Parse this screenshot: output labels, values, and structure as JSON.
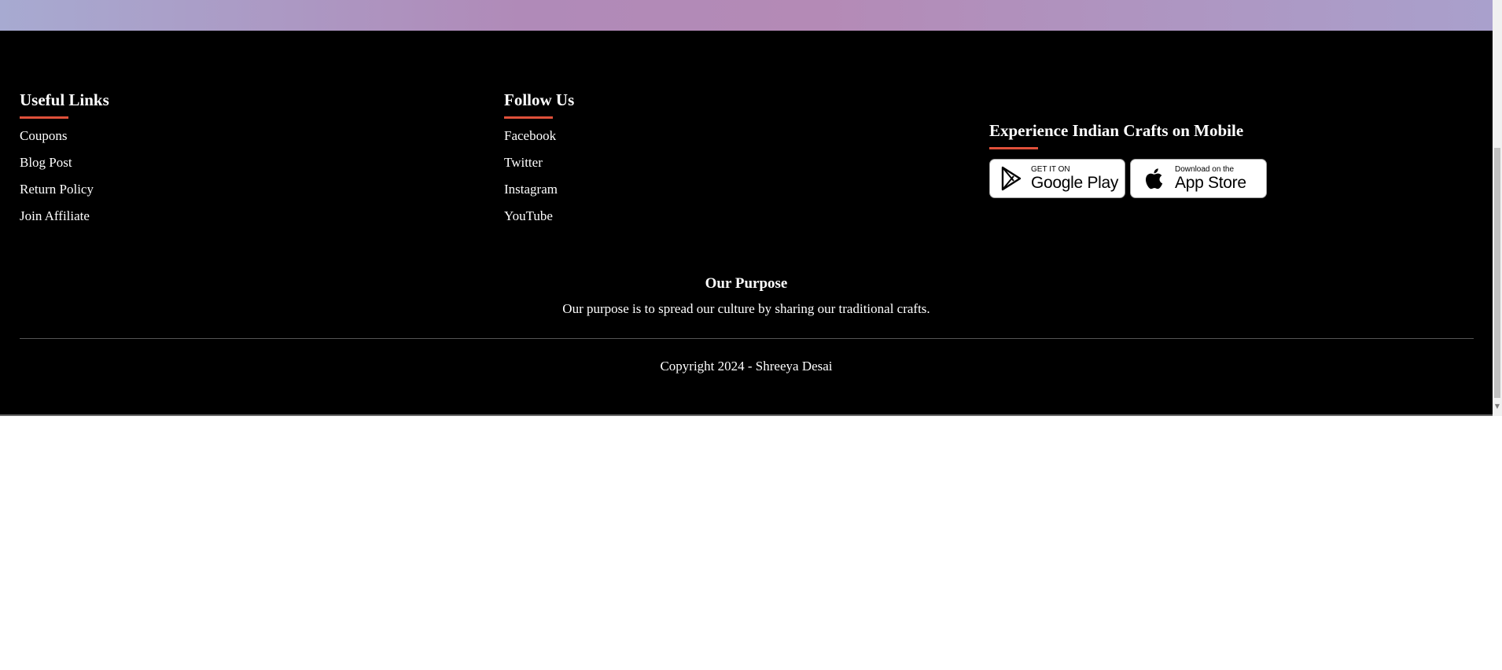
{
  "footer": {
    "useful_links": {
      "title": "Useful Links",
      "items": [
        "Coupons",
        "Blog Post",
        "Return Policy",
        "Join Affiliate"
      ]
    },
    "follow_us": {
      "title": "Follow Us",
      "items": [
        "Facebook",
        "Twitter",
        "Instagram",
        "YouTube"
      ]
    },
    "mobile": {
      "title": "Experience Indian Crafts on Mobile",
      "google_play": {
        "small": "GET IT ON",
        "big": "Google Play",
        "icon": "google-play-icon"
      },
      "app_store": {
        "small": "Download on the",
        "big": "App Store",
        "icon": "apple-icon"
      }
    },
    "purpose": {
      "title": "Our Purpose",
      "text": "Our purpose is to spread our culture by sharing our traditional crafts."
    },
    "copyright": "Copyright 2024 - Shreeya Desai"
  },
  "colors": {
    "footer_bg": "#000000",
    "accent_underline": "#e0503a",
    "hero_gradient_start": "#a7aad1",
    "hero_gradient_mid": "#b48ab6"
  }
}
